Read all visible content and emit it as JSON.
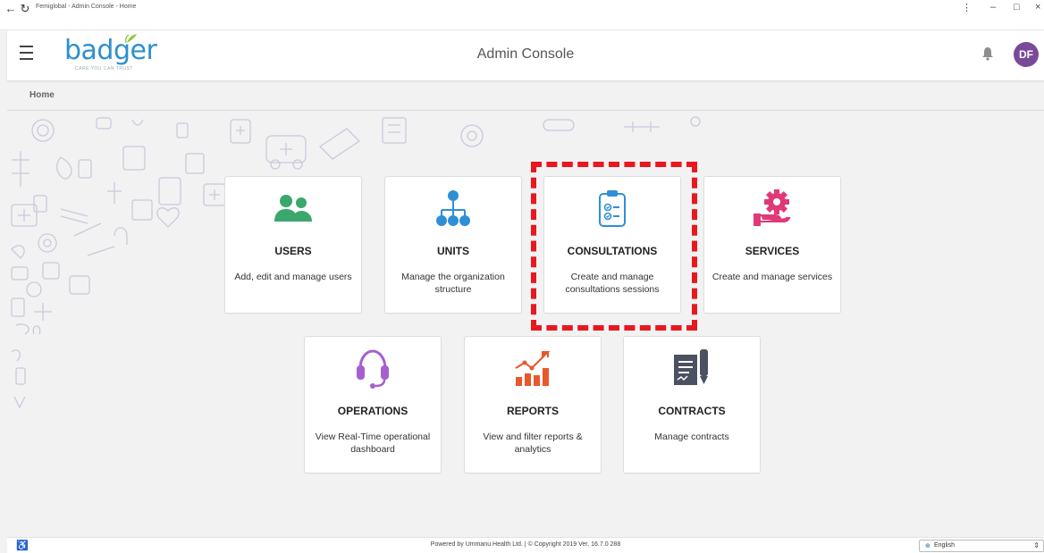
{
  "window": {
    "title": "Femiglobal - Admin Console - Home",
    "back_icon": "←",
    "reload_icon": "↻",
    "menu_icon": "⋮",
    "minimize_icon": "–",
    "maximize_icon": "□",
    "close_icon": "×"
  },
  "header": {
    "logo_text": "badger",
    "logo_tagline": "CARE YOU CAN TRUST",
    "title": "Admin Console",
    "avatar_initials": "DF"
  },
  "breadcrumb": {
    "current": "Home"
  },
  "tiles": [
    {
      "name": "USERS",
      "desc": "Add, edit and manage users",
      "icon": "users-icon",
      "color": "#3aa86c"
    },
    {
      "name": "UNITS",
      "desc": "Manage the organization structure",
      "icon": "hierarchy-icon",
      "color": "#2f8fd5"
    },
    {
      "name": "CONSULTATIONS",
      "desc": "Create and manage consultations sessions",
      "icon": "clipboard-checklist-icon",
      "color": "#2f8fd5"
    },
    {
      "name": "SERVICES",
      "desc": "Create and manage services",
      "icon": "gear-hand-icon",
      "color": "#e0397a"
    },
    {
      "name": "OPERATIONS",
      "desc": "View Real-Time operational dashboard",
      "icon": "headset-icon",
      "color": "#a55fd0"
    },
    {
      "name": "REPORTS",
      "desc": "View and filter reports & analytics",
      "icon": "bar-chart-icon",
      "color": "#e8582a"
    },
    {
      "name": "CONTRACTS",
      "desc": "Manage contracts",
      "icon": "contract-pen-icon",
      "color": "#4a5160"
    }
  ],
  "footer": {
    "copyright": "Powered by Ummanu Health Ltd. | © Copyright 2019 Ver. 16.7.0 288",
    "accessibility_icon": "♿",
    "language": "English"
  },
  "colors": {
    "highlight": "#e8181e",
    "avatar": "#7a4a99",
    "logo": "#2d8fd0"
  }
}
